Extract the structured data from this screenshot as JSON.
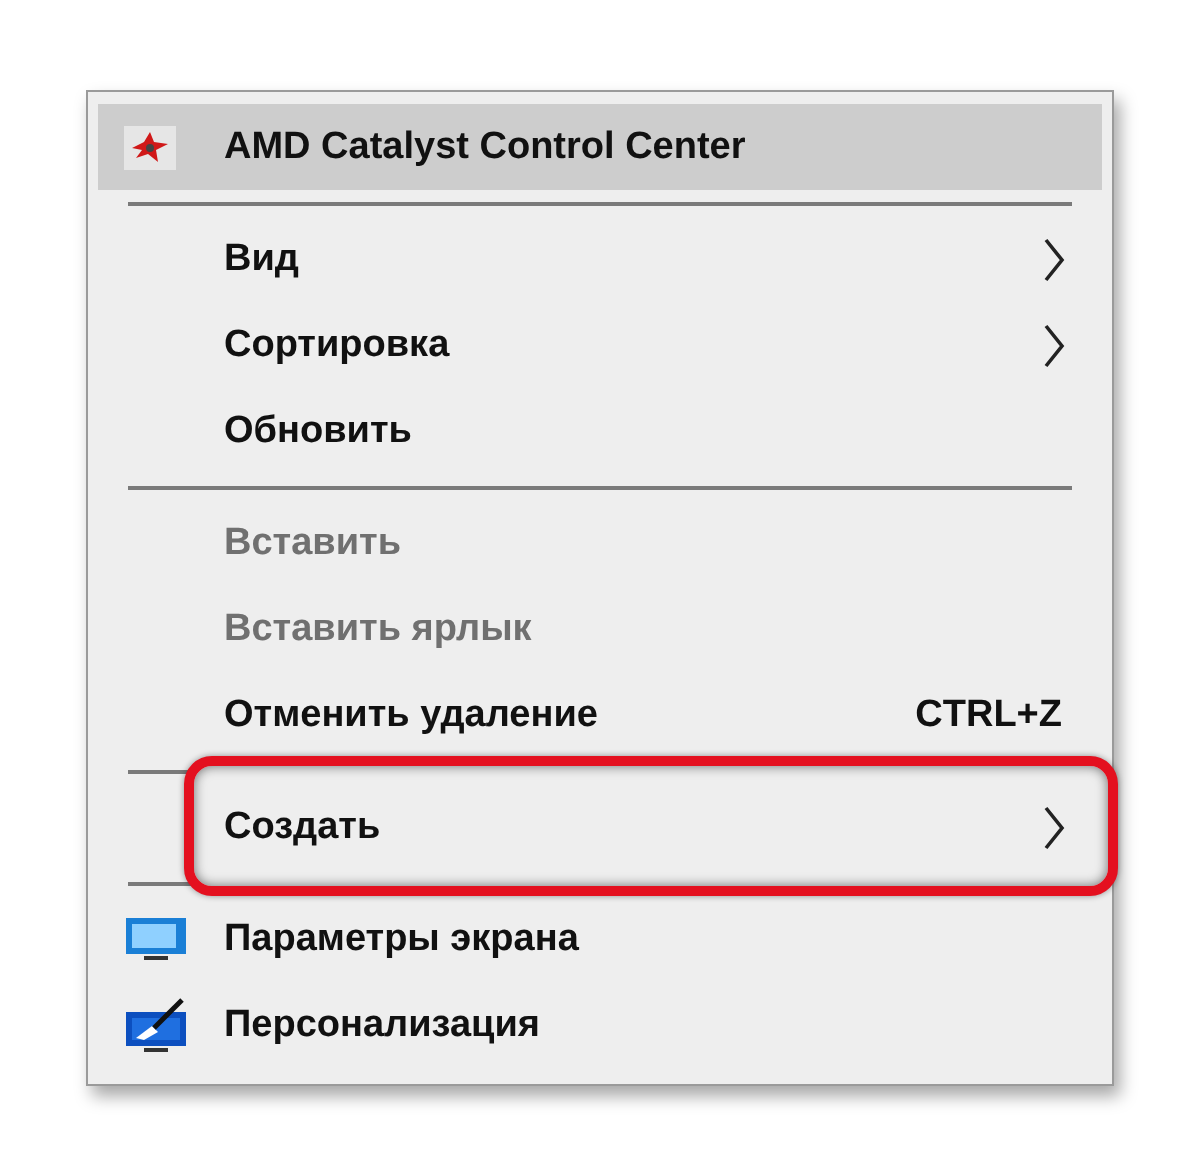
{
  "context_menu": {
    "items": [
      {
        "kind": "app",
        "label": "AMD Catalyst Control Center",
        "selected": true,
        "disabled": false,
        "submenu": false,
        "highlighted": false
      },
      {
        "kind": "separator"
      },
      {
        "kind": "command",
        "label": "Вид",
        "selected": false,
        "disabled": false,
        "submenu": true,
        "highlighted": false
      },
      {
        "kind": "command",
        "label": "Сортировка",
        "selected": false,
        "disabled": false,
        "submenu": true,
        "highlighted": false
      },
      {
        "kind": "command",
        "label": "Обновить",
        "selected": false,
        "disabled": false,
        "submenu": false,
        "highlighted": false
      },
      {
        "kind": "separator"
      },
      {
        "kind": "command",
        "label": "Вставить",
        "selected": false,
        "disabled": true,
        "submenu": false,
        "highlighted": false
      },
      {
        "kind": "command",
        "label": "Вставить ярлык",
        "selected": false,
        "disabled": true,
        "submenu": false,
        "highlighted": false
      },
      {
        "kind": "command",
        "label": "Отменить удаление",
        "shortcut": "CTRL+Z",
        "selected": false,
        "disabled": false,
        "submenu": false,
        "highlighted": false
      },
      {
        "kind": "separator"
      },
      {
        "kind": "command",
        "label": "Создать",
        "selected": false,
        "disabled": false,
        "submenu": true,
        "highlighted": true
      },
      {
        "kind": "separator"
      },
      {
        "kind": "display",
        "label": "Параметры экрана",
        "selected": false,
        "disabled": false,
        "submenu": false,
        "highlighted": false
      },
      {
        "kind": "personalize",
        "label": "Персонализация",
        "selected": false,
        "disabled": false,
        "submenu": false,
        "highlighted": false
      }
    ]
  }
}
